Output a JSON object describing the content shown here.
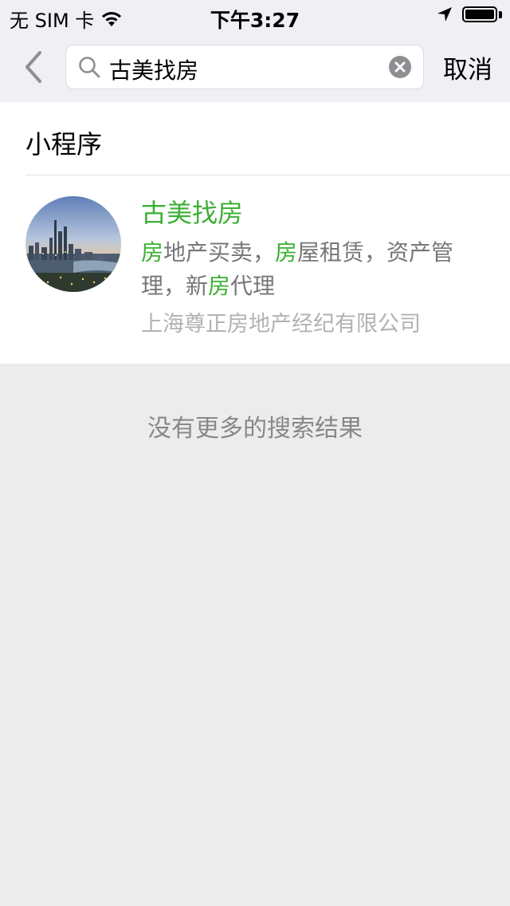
{
  "status_bar": {
    "carrier": "无 SIM 卡",
    "time": "下午3:27",
    "icons": [
      "wifi-icon",
      "location-arrow-icon",
      "battery-icon"
    ]
  },
  "search": {
    "query": "古美找房",
    "cancel_label": "取消",
    "icons": [
      "back-chevron-icon",
      "search-icon",
      "clear-icon"
    ]
  },
  "section": {
    "title": "小程序"
  },
  "result": {
    "title": "古美找房",
    "desc_segments": [
      {
        "text": "房",
        "highlight": true
      },
      {
        "text": "地产买卖，",
        "highlight": false
      },
      {
        "text": "房",
        "highlight": true
      },
      {
        "text": "屋租赁，资产管理，新",
        "highlight": false
      },
      {
        "text": "房",
        "highlight": true
      },
      {
        "text": "代理",
        "highlight": false
      }
    ],
    "organization": "上海尊正房地产经纪有限公司",
    "avatar_image": "city-skyline-photo"
  },
  "footer": {
    "no_more_text": "没有更多的搜索结果"
  },
  "colors": {
    "highlight": "#3cb034",
    "background": "#ececec",
    "header_bg": "#efeff4"
  }
}
